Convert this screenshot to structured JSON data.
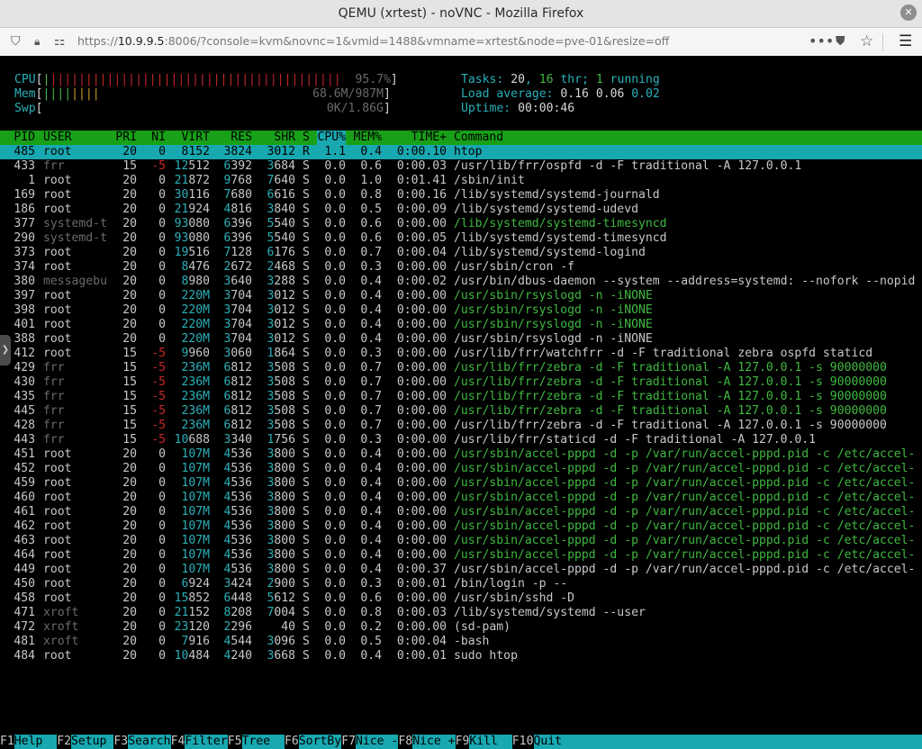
{
  "window": {
    "title": "QEMU (xrtest) - noVNC - Mozilla Firefox"
  },
  "browser": {
    "url_prefix": "https://",
    "url_host": "10.9.9.5",
    "url_rest": ":8006/?console=kvm&novnc=1&vmid=1488&vmname=xrtest&node=pve-01&resize=off"
  },
  "meters": {
    "cpu_label": "CPU",
    "cpu_value": "95.7%",
    "cpu_fraction": 0.957,
    "mem_label": "Mem",
    "mem_value": "68.6M/987M",
    "swp_label": "Swp",
    "swp_value": "0K/1.86G",
    "tasks_label": "Tasks: ",
    "tasks_count": "20",
    "tasks_sep": ", ",
    "threads": "16",
    "thr_label": " thr; ",
    "running": "1",
    "running_label": " running",
    "load_label": "Load average: ",
    "load1": "0.16",
    "load5": "0.06",
    "load15": "0.02",
    "uptime_label": "Uptime: ",
    "uptime": "00:00:46"
  },
  "columns": [
    "PID",
    "USER",
    "PRI",
    "NI",
    "VIRT",
    "RES",
    "SHR",
    "S",
    "CPU%",
    "MEM%",
    "TIME+",
    "Command"
  ],
  "processes": [
    {
      "pid": "485",
      "user": "root",
      "pri": "20",
      "ni": "0",
      "virt": "8152",
      "res": "3824",
      "shr": "3012",
      "s": "R",
      "cpu": "1.1",
      "mem": "0.4",
      "time": "0:00.10",
      "cmd": "htop",
      "sel": true
    },
    {
      "pid": "433",
      "user": "frr",
      "pri": "15",
      "ni": "-5",
      "virt": "12512",
      "res": "6392",
      "shr": "3684",
      "s": "S",
      "cpu": "0.0",
      "mem": "0.6",
      "time": "0:00.03",
      "cmd": "/usr/lib/frr/ospfd -d -F traditional -A 127.0.0.1"
    },
    {
      "pid": "1",
      "user": "root",
      "pri": "20",
      "ni": "0",
      "virt": "21872",
      "res": "9768",
      "shr": "7640",
      "s": "S",
      "cpu": "0.0",
      "mem": "1.0",
      "time": "0:01.41",
      "cmd": "/sbin/init"
    },
    {
      "pid": "169",
      "user": "root",
      "pri": "20",
      "ni": "0",
      "virt": "30116",
      "res": "7680",
      "shr": "6616",
      "s": "S",
      "cpu": "0.0",
      "mem": "0.8",
      "time": "0:00.16",
      "cmd": "/lib/systemd/systemd-journald"
    },
    {
      "pid": "186",
      "user": "root",
      "pri": "20",
      "ni": "0",
      "virt": "21924",
      "res": "4816",
      "shr": "3840",
      "s": "S",
      "cpu": "0.0",
      "mem": "0.5",
      "time": "0:00.09",
      "cmd": "/lib/systemd/systemd-udevd"
    },
    {
      "pid": "377",
      "user": "systemd-t",
      "pri": "20",
      "ni": "0",
      "virt": "93080",
      "res": "6396",
      "shr": "5540",
      "s": "S",
      "cpu": "0.0",
      "mem": "0.6",
      "time": "0:00.00",
      "cmd": "/lib/systemd/systemd-timesyncd",
      "thread": true
    },
    {
      "pid": "290",
      "user": "systemd-t",
      "pri": "20",
      "ni": "0",
      "virt": "93080",
      "res": "6396",
      "shr": "5540",
      "s": "S",
      "cpu": "0.0",
      "mem": "0.6",
      "time": "0:00.05",
      "cmd": "/lib/systemd/systemd-timesyncd"
    },
    {
      "pid": "373",
      "user": "root",
      "pri": "20",
      "ni": "0",
      "virt": "19516",
      "res": "7128",
      "shr": "6176",
      "s": "S",
      "cpu": "0.0",
      "mem": "0.7",
      "time": "0:00.04",
      "cmd": "/lib/systemd/systemd-logind"
    },
    {
      "pid": "374",
      "user": "root",
      "pri": "20",
      "ni": "0",
      "virt": "8476",
      "res": "2672",
      "shr": "2468",
      "s": "S",
      "cpu": "0.0",
      "mem": "0.3",
      "time": "0:00.00",
      "cmd": "/usr/sbin/cron -f"
    },
    {
      "pid": "380",
      "user": "messagebu",
      "pri": "20",
      "ni": "0",
      "virt": "8980",
      "res": "3640",
      "shr": "3288",
      "s": "S",
      "cpu": "0.0",
      "mem": "0.4",
      "time": "0:00.02",
      "cmd": "/usr/bin/dbus-daemon --system --address=systemd: --nofork --nopid"
    },
    {
      "pid": "397",
      "user": "root",
      "pri": "20",
      "ni": "0",
      "virt": "220M",
      "res": "3704",
      "shr": "3012",
      "s": "S",
      "cpu": "0.0",
      "mem": "0.4",
      "time": "0:00.00",
      "cmd": "/usr/sbin/rsyslogd -n -iNONE",
      "thread": true
    },
    {
      "pid": "398",
      "user": "root",
      "pri": "20",
      "ni": "0",
      "virt": "220M",
      "res": "3704",
      "shr": "3012",
      "s": "S",
      "cpu": "0.0",
      "mem": "0.4",
      "time": "0:00.00",
      "cmd": "/usr/sbin/rsyslogd -n -iNONE",
      "thread": true
    },
    {
      "pid": "401",
      "user": "root",
      "pri": "20",
      "ni": "0",
      "virt": "220M",
      "res": "3704",
      "shr": "3012",
      "s": "S",
      "cpu": "0.0",
      "mem": "0.4",
      "time": "0:00.00",
      "cmd": "/usr/sbin/rsyslogd -n -iNONE",
      "thread": true
    },
    {
      "pid": "388",
      "user": "root",
      "pri": "20",
      "ni": "0",
      "virt": "220M",
      "res": "3704",
      "shr": "3012",
      "s": "S",
      "cpu": "0.0",
      "mem": "0.4",
      "time": "0:00.00",
      "cmd": "/usr/sbin/rsyslogd -n -iNONE"
    },
    {
      "pid": "412",
      "user": "root",
      "pri": "15",
      "ni": "-5",
      "virt": "9960",
      "res": "3060",
      "shr": "1864",
      "s": "S",
      "cpu": "0.0",
      "mem": "0.3",
      "time": "0:00.00",
      "cmd": "/usr/lib/frr/watchfrr -d -F traditional zebra ospfd staticd"
    },
    {
      "pid": "429",
      "user": "frr",
      "pri": "15",
      "ni": "-5",
      "virt": "236M",
      "res": "6812",
      "shr": "3508",
      "s": "S",
      "cpu": "0.0",
      "mem": "0.7",
      "time": "0:00.00",
      "cmd": "/usr/lib/frr/zebra -d -F traditional -A 127.0.0.1 -s 90000000",
      "thread": true
    },
    {
      "pid": "430",
      "user": "frr",
      "pri": "15",
      "ni": "-5",
      "virt": "236M",
      "res": "6812",
      "shr": "3508",
      "s": "S",
      "cpu": "0.0",
      "mem": "0.7",
      "time": "0:00.00",
      "cmd": "/usr/lib/frr/zebra -d -F traditional -A 127.0.0.1 -s 90000000",
      "thread": true
    },
    {
      "pid": "435",
      "user": "frr",
      "pri": "15",
      "ni": "-5",
      "virt": "236M",
      "res": "6812",
      "shr": "3508",
      "s": "S",
      "cpu": "0.0",
      "mem": "0.7",
      "time": "0:00.00",
      "cmd": "/usr/lib/frr/zebra -d -F traditional -A 127.0.0.1 -s 90000000",
      "thread": true
    },
    {
      "pid": "445",
      "user": "frr",
      "pri": "15",
      "ni": "-5",
      "virt": "236M",
      "res": "6812",
      "shr": "3508",
      "s": "S",
      "cpu": "0.0",
      "mem": "0.7",
      "time": "0:00.00",
      "cmd": "/usr/lib/frr/zebra -d -F traditional -A 127.0.0.1 -s 90000000",
      "thread": true
    },
    {
      "pid": "428",
      "user": "frr",
      "pri": "15",
      "ni": "-5",
      "virt": "236M",
      "res": "6812",
      "shr": "3508",
      "s": "S",
      "cpu": "0.0",
      "mem": "0.7",
      "time": "0:00.00",
      "cmd": "/usr/lib/frr/zebra -d -F traditional -A 127.0.0.1 -s 90000000"
    },
    {
      "pid": "443",
      "user": "frr",
      "pri": "15",
      "ni": "-5",
      "virt": "10688",
      "res": "3340",
      "shr": "1756",
      "s": "S",
      "cpu": "0.0",
      "mem": "0.3",
      "time": "0:00.00",
      "cmd": "/usr/lib/frr/staticd -d -F traditional -A 127.0.0.1"
    },
    {
      "pid": "451",
      "user": "root",
      "pri": "20",
      "ni": "0",
      "virt": "107M",
      "res": "4536",
      "shr": "3800",
      "s": "S",
      "cpu": "0.0",
      "mem": "0.4",
      "time": "0:00.00",
      "cmd": "/usr/sbin/accel-pppd -d -p /var/run/accel-pppd.pid -c /etc/accel-",
      "thread": true
    },
    {
      "pid": "452",
      "user": "root",
      "pri": "20",
      "ni": "0",
      "virt": "107M",
      "res": "4536",
      "shr": "3800",
      "s": "S",
      "cpu": "0.0",
      "mem": "0.4",
      "time": "0:00.00",
      "cmd": "/usr/sbin/accel-pppd -d -p /var/run/accel-pppd.pid -c /etc/accel-",
      "thread": true
    },
    {
      "pid": "459",
      "user": "root",
      "pri": "20",
      "ni": "0",
      "virt": "107M",
      "res": "4536",
      "shr": "3800",
      "s": "S",
      "cpu": "0.0",
      "mem": "0.4",
      "time": "0:00.00",
      "cmd": "/usr/sbin/accel-pppd -d -p /var/run/accel-pppd.pid -c /etc/accel-",
      "thread": true
    },
    {
      "pid": "460",
      "user": "root",
      "pri": "20",
      "ni": "0",
      "virt": "107M",
      "res": "4536",
      "shr": "3800",
      "s": "S",
      "cpu": "0.0",
      "mem": "0.4",
      "time": "0:00.00",
      "cmd": "/usr/sbin/accel-pppd -d -p /var/run/accel-pppd.pid -c /etc/accel-",
      "thread": true
    },
    {
      "pid": "461",
      "user": "root",
      "pri": "20",
      "ni": "0",
      "virt": "107M",
      "res": "4536",
      "shr": "3800",
      "s": "S",
      "cpu": "0.0",
      "mem": "0.4",
      "time": "0:00.00",
      "cmd": "/usr/sbin/accel-pppd -d -p /var/run/accel-pppd.pid -c /etc/accel-",
      "thread": true
    },
    {
      "pid": "462",
      "user": "root",
      "pri": "20",
      "ni": "0",
      "virt": "107M",
      "res": "4536",
      "shr": "3800",
      "s": "S",
      "cpu": "0.0",
      "mem": "0.4",
      "time": "0:00.00",
      "cmd": "/usr/sbin/accel-pppd -d -p /var/run/accel-pppd.pid -c /etc/accel-",
      "thread": true
    },
    {
      "pid": "463",
      "user": "root",
      "pri": "20",
      "ni": "0",
      "virt": "107M",
      "res": "4536",
      "shr": "3800",
      "s": "S",
      "cpu": "0.0",
      "mem": "0.4",
      "time": "0:00.00",
      "cmd": "/usr/sbin/accel-pppd -d -p /var/run/accel-pppd.pid -c /etc/accel-",
      "thread": true
    },
    {
      "pid": "464",
      "user": "root",
      "pri": "20",
      "ni": "0",
      "virt": "107M",
      "res": "4536",
      "shr": "3800",
      "s": "S",
      "cpu": "0.0",
      "mem": "0.4",
      "time": "0:00.00",
      "cmd": "/usr/sbin/accel-pppd -d -p /var/run/accel-pppd.pid -c /etc/accel-",
      "thread": true
    },
    {
      "pid": "449",
      "user": "root",
      "pri": "20",
      "ni": "0",
      "virt": "107M",
      "res": "4536",
      "shr": "3800",
      "s": "S",
      "cpu": "0.0",
      "mem": "0.4",
      "time": "0:00.37",
      "cmd": "/usr/sbin/accel-pppd -d -p /var/run/accel-pppd.pid -c /etc/accel-"
    },
    {
      "pid": "450",
      "user": "root",
      "pri": "20",
      "ni": "0",
      "virt": "6924",
      "res": "3424",
      "shr": "2900",
      "s": "S",
      "cpu": "0.0",
      "mem": "0.3",
      "time": "0:00.01",
      "cmd": "/bin/login -p --"
    },
    {
      "pid": "458",
      "user": "root",
      "pri": "20",
      "ni": "0",
      "virt": "15852",
      "res": "6448",
      "shr": "5612",
      "s": "S",
      "cpu": "0.0",
      "mem": "0.6",
      "time": "0:00.00",
      "cmd": "/usr/sbin/sshd -D"
    },
    {
      "pid": "471",
      "user": "xroft",
      "pri": "20",
      "ni": "0",
      "virt": "21152",
      "res": "8208",
      "shr": "7004",
      "s": "S",
      "cpu": "0.0",
      "mem": "0.8",
      "time": "0:00.03",
      "cmd": "/lib/systemd/systemd --user"
    },
    {
      "pid": "472",
      "user": "xroft",
      "pri": "20",
      "ni": "0",
      "virt": "23120",
      "res": "2296",
      "shr": "40",
      "s": "S",
      "cpu": "0.0",
      "mem": "0.2",
      "time": "0:00.00",
      "cmd": "(sd-pam)"
    },
    {
      "pid": "481",
      "user": "xroft",
      "pri": "20",
      "ni": "0",
      "virt": "7916",
      "res": "4544",
      "shr": "3096",
      "s": "S",
      "cpu": "0.0",
      "mem": "0.5",
      "time": "0:00.04",
      "cmd": "-bash"
    },
    {
      "pid": "484",
      "user": "root",
      "pri": "20",
      "ni": "0",
      "virt": "10484",
      "res": "4240",
      "shr": "3668",
      "s": "S",
      "cpu": "0.0",
      "mem": "0.4",
      "time": "0:00.01",
      "cmd": "sudo htop"
    }
  ],
  "fkeys": [
    {
      "key": "F1",
      "label": "Help  "
    },
    {
      "key": "F2",
      "label": "Setup "
    },
    {
      "key": "F3",
      "label": "Search"
    },
    {
      "key": "F4",
      "label": "Filter"
    },
    {
      "key": "F5",
      "label": "Tree  "
    },
    {
      "key": "F6",
      "label": "SortBy"
    },
    {
      "key": "F7",
      "label": "Nice -"
    },
    {
      "key": "F8",
      "label": "Nice +"
    },
    {
      "key": "F9",
      "label": "Kill  "
    },
    {
      "key": "F10",
      "label": "Quit  "
    }
  ],
  "colors": {
    "cyan": "#18a8b0",
    "green": "#18a018",
    "red": "#c82828",
    "header_green": "#40b840"
  }
}
